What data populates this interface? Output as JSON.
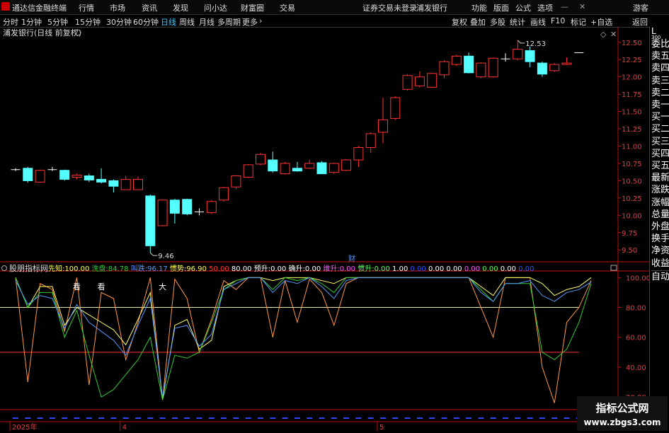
{
  "titlebar": {
    "app_title": "通达信金融终端",
    "menu": [
      "行情",
      "市场",
      "资讯",
      "发现",
      "问小达",
      "财富圈",
      "交易"
    ],
    "login_notice": "证券交易未登录",
    "stock_name": "浦发银行",
    "right_menu": [
      "功能",
      "版面",
      "公式",
      "选项"
    ],
    "user": "游客"
  },
  "toolbar": {
    "periods": [
      "分时",
      "1分钟",
      "5分钟",
      "15分钟",
      "30分钟",
      "60分钟",
      "日线",
      "周线",
      "月线",
      "多周期",
      "更多"
    ],
    "active_period": "日线",
    "right_items": [
      "复权",
      "叠加",
      "多股",
      "统计",
      "画线",
      "F10",
      "标记",
      "+自选",
      "返回"
    ]
  },
  "right_panel": {
    "corner": "L",
    "corner_sub": "300",
    "items": [
      "委比",
      "卖五",
      "卖四",
      "卖三",
      "卖二",
      "卖一",
      "买一",
      "买二",
      "买三",
      "买四",
      "买五",
      "最新",
      "涨跌",
      "涨幅",
      "总量",
      "外盘",
      "换手",
      "净资",
      "收益",
      "自动"
    ]
  },
  "chart_data": [
    {
      "type": "candlestick",
      "title": "浦发银行(日线 前复权)",
      "ylim": [
        9.4,
        12.6
      ],
      "yticks": [
        9.5,
        9.75,
        10.0,
        10.25,
        10.5,
        10.75,
        11.0,
        11.25,
        11.5,
        11.75,
        12.0,
        12.25,
        12.5
      ],
      "annotations": {
        "high": "12.53",
        "low": "9.46",
        "marker": "财"
      },
      "candles": [
        {
          "o": 10.66,
          "c": 10.66,
          "h": 10.68,
          "l": 10.64
        },
        {
          "o": 10.68,
          "c": 10.5,
          "h": 10.7,
          "l": 10.47
        },
        {
          "o": 10.48,
          "c": 10.65,
          "h": 10.66,
          "l": 10.47
        },
        {
          "o": 10.66,
          "c": 10.66,
          "h": 10.7,
          "l": 10.64
        },
        {
          "o": 10.65,
          "c": 10.52,
          "h": 10.66,
          "l": 10.5
        },
        {
          "o": 10.55,
          "c": 10.58,
          "h": 10.6,
          "l": 10.52
        },
        {
          "o": 10.57,
          "c": 10.51,
          "h": 10.6,
          "l": 10.48
        },
        {
          "o": 10.52,
          "c": 10.48,
          "h": 10.68,
          "l": 10.46
        },
        {
          "o": 10.5,
          "c": 10.42,
          "h": 10.52,
          "l": 10.33
        },
        {
          "o": 10.37,
          "c": 10.52,
          "h": 10.57,
          "l": 10.37
        },
        {
          "o": 10.37,
          "c": 10.52,
          "h": 10.56,
          "l": 10.37
        },
        {
          "o": 10.28,
          "c": 9.56,
          "h": 10.3,
          "l": 9.46
        },
        {
          "o": 9.85,
          "c": 10.22,
          "h": 10.23,
          "l": 9.84
        },
        {
          "o": 10.22,
          "c": 10.03,
          "h": 10.24,
          "l": 9.88
        },
        {
          "o": 10.23,
          "c": 10.02,
          "h": 10.24,
          "l": 10.0
        },
        {
          "o": 10.05,
          "c": 10.05,
          "h": 10.1,
          "l": 10.0
        },
        {
          "o": 10.04,
          "c": 10.2,
          "h": 10.22,
          "l": 10.02
        },
        {
          "o": 10.22,
          "c": 10.4,
          "h": 10.41,
          "l": 10.2
        },
        {
          "o": 10.41,
          "c": 10.57,
          "h": 10.58,
          "l": 10.38
        },
        {
          "o": 10.55,
          "c": 10.73,
          "h": 10.74,
          "l": 10.54
        },
        {
          "o": 10.74,
          "c": 10.88,
          "h": 10.9,
          "l": 10.72
        },
        {
          "o": 10.8,
          "c": 10.64,
          "h": 10.92,
          "l": 10.62
        },
        {
          "o": 10.6,
          "c": 10.75,
          "h": 10.77,
          "l": 10.59
        },
        {
          "o": 10.68,
          "c": 10.64,
          "h": 10.77,
          "l": 10.63
        },
        {
          "o": 10.68,
          "c": 10.75,
          "h": 10.8,
          "l": 10.67
        },
        {
          "o": 10.76,
          "c": 10.6,
          "h": 10.78,
          "l": 10.6
        },
        {
          "o": 10.62,
          "c": 10.75,
          "h": 10.76,
          "l": 10.6
        },
        {
          "o": 10.65,
          "c": 10.8,
          "h": 10.81,
          "l": 10.64
        },
        {
          "o": 10.8,
          "c": 10.98,
          "h": 11.0,
          "l": 10.7
        },
        {
          "o": 10.98,
          "c": 11.18,
          "h": 11.2,
          "l": 10.9
        },
        {
          "o": 11.2,
          "c": 11.38,
          "h": 11.7,
          "l": 11.04
        },
        {
          "o": 11.4,
          "c": 11.7,
          "h": 11.72,
          "l": 11.38
        },
        {
          "o": 11.82,
          "c": 12.02,
          "h": 12.04,
          "l": 11.8
        },
        {
          "o": 11.87,
          "c": 12.0,
          "h": 12.08,
          "l": 11.85
        },
        {
          "o": 11.85,
          "c": 12.05,
          "h": 12.06,
          "l": 11.84
        },
        {
          "o": 12.03,
          "c": 12.22,
          "h": 12.24,
          "l": 11.98
        },
        {
          "o": 12.18,
          "c": 12.3,
          "h": 12.32,
          "l": 12.16
        },
        {
          "o": 12.3,
          "c": 12.06,
          "h": 12.35,
          "l": 12.05
        },
        {
          "o": 12.0,
          "c": 12.2,
          "h": 12.21,
          "l": 11.98
        },
        {
          "o": 12.0,
          "c": 12.27,
          "h": 12.28,
          "l": 11.99
        },
        {
          "o": 12.26,
          "c": 12.26,
          "h": 12.34,
          "l": 12.22
        },
        {
          "o": 12.26,
          "c": 12.4,
          "h": 12.53,
          "l": 12.24
        },
        {
          "o": 12.38,
          "c": 12.22,
          "h": 12.44,
          "l": 12.14
        },
        {
          "o": 12.2,
          "c": 12.04,
          "h": 12.22,
          "l": 12.0
        },
        {
          "o": 12.09,
          "c": 12.18,
          "h": 12.2,
          "l": 12.07
        },
        {
          "o": 12.18,
          "c": 12.2,
          "h": 12.28,
          "l": 12.17
        },
        {
          "o": 12.35,
          "c": 12.35,
          "h": 12.35,
          "l": 12.35
        }
      ]
    },
    {
      "type": "line",
      "title": "股朋指标网",
      "ylim": [
        12,
        103
      ],
      "yticks": [
        20,
        40,
        60,
        80,
        100
      ],
      "legend": [
        {
          "label": "先知:",
          "value": "100.00",
          "color": "#ffff55"
        },
        {
          "label": "洗盘:",
          "value": "84.78",
          "color": "#33cc33"
        },
        {
          "label": "叫跌:",
          "value": "96.17",
          "color": "#5599ff"
        },
        {
          "label": "惯势:",
          "value": "96.90",
          "color": "#ffff55"
        },
        {
          "label": "",
          "value": "50.00",
          "color": "#ff3333"
        },
        {
          "label": "",
          "value": "80.00",
          "color": "#ffffff"
        },
        {
          "label": "预升:",
          "value": "0.00",
          "color": "#ffffff"
        },
        {
          "label": "确升:",
          "value": "0.00",
          "color": "#ffffff"
        },
        {
          "label": "维升:",
          "value": "0.00",
          "color": "#ff55ff"
        },
        {
          "label": "惯升:",
          "value": "0.00",
          "color": "#55ff55"
        },
        {
          "label": "",
          "value": "1.00",
          "color": "#ffffff"
        },
        {
          "label": "",
          "value": "0.00",
          "color": "#3355ff"
        },
        {
          "label": "",
          "value": "0.00",
          "color": "#ffffff"
        },
        {
          "label": "",
          "value": "0.00",
          "color": "#ffffff"
        },
        {
          "label": "",
          "value": "0.00",
          "color": "#ff55ff"
        },
        {
          "label": "",
          "value": "0.00",
          "color": "#55ff55"
        },
        {
          "label": "",
          "value": "0.00",
          "color": "#ffffff"
        },
        {
          "label": "",
          "value": "0.00",
          "color": "#3355ff"
        }
      ],
      "hlines": [
        {
          "value": 80,
          "color": "#e8e8a0"
        },
        {
          "value": 50,
          "color": "#ff3333"
        }
      ],
      "text_marks": [
        {
          "text": "看",
          "i": 5
        },
        {
          "text": "看",
          "i": 7
        },
        {
          "text": "大",
          "i": 12
        }
      ],
      "series": [
        {
          "color": "#ff9944",
          "values": [
            100,
            30,
            96,
            92,
            64,
            100,
            28,
            90,
            86,
            45,
            70,
            100,
            18,
            99,
            86,
            50,
            72,
            98,
            92,
            100,
            100,
            60,
            98,
            70,
            99,
            90,
            68,
            96,
            100,
            100,
            100,
            100,
            100,
            100,
            100,
            100,
            100,
            100,
            80,
            60,
            100,
            100,
            100,
            40,
            16,
            70,
            80,
            98
          ]
        },
        {
          "color": "#ffff66",
          "values": [
            100,
            80,
            94,
            94,
            68,
            80,
            75,
            70,
            65,
            55,
            72,
            90,
            18,
            68,
            72,
            52,
            58,
            94,
            98,
            100,
            100,
            98,
            100,
            100,
            100,
            98,
            96,
            100,
            100,
            100,
            100,
            100,
            100,
            100,
            100,
            100,
            100,
            100,
            94,
            88,
            100,
            100,
            100,
            96,
            88,
            92,
            94,
            100
          ]
        },
        {
          "color": "#33cc33",
          "values": [
            100,
            80,
            90,
            90,
            60,
            78,
            48,
            20,
            25,
            35,
            45,
            60,
            18,
            48,
            46,
            50,
            70,
            92,
            98,
            100,
            100,
            92,
            100,
            98,
            100,
            96,
            90,
            100,
            100,
            100,
            100,
            100,
            100,
            100,
            100,
            100,
            100,
            100,
            92,
            84,
            96,
            96,
            96,
            50,
            45,
            52,
            70,
            96
          ]
        },
        {
          "color": "#5599ff",
          "values": [
            98,
            82,
            88,
            86,
            66,
            82,
            70,
            64,
            58,
            48,
            68,
            86,
            20,
            66,
            68,
            54,
            62,
            92,
            96,
            100,
            100,
            90,
            98,
            96,
            100,
            94,
            86,
            98,
            100,
            100,
            100,
            100,
            100,
            100,
            100,
            100,
            100,
            100,
            90,
            84,
            96,
            96,
            98,
            88,
            84,
            90,
            92,
            97
          ]
        }
      ],
      "xticks": [
        {
          "label": "2025年",
          "i": 0
        },
        {
          "label": "4",
          "i": 9
        },
        {
          "label": "5",
          "i": 30
        }
      ]
    }
  ]
}
